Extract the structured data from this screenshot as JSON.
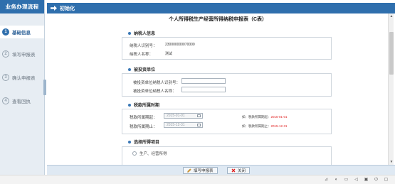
{
  "sidebar": {
    "title": "业务办理流程",
    "items": [
      {
        "num": "1",
        "label": "基础信息",
        "active": true
      },
      {
        "num": "2",
        "label": "填写申报表",
        "active": false
      },
      {
        "num": "3",
        "label": "确认申报表",
        "active": false
      },
      {
        "num": "4",
        "label": "查看回执",
        "active": false
      }
    ]
  },
  "header": {
    "title": "初始化"
  },
  "form": {
    "title": "个人所得税生产经营所得纳税申报表（C表）",
    "taxpayer": {
      "heading": "纳税人信息",
      "id_label": "纳税人识别号：",
      "id_value": "230000000070000",
      "name_label": "纳税人名称：",
      "name_value": "测试"
    },
    "invested": {
      "heading": "被投资单位",
      "id_label": "被投资单位纳税人识别号：",
      "id_value": "",
      "name_label": "被投资单位纳税人名称：",
      "name_value": ""
    },
    "period": {
      "heading": "税款所属时期",
      "start_label": "税款所属期起：",
      "start_value": "2015-01-01",
      "start_hint_prefix": "如：税款所属期起：",
      "start_hint_value": "2015-01-01",
      "end_label": "税款所属期止：",
      "end_value": "2015-12-31",
      "end_hint_prefix": "如：税款所属期止：",
      "end_hint_value": "2015-12-31"
    },
    "income": {
      "heading": "选择所得项目",
      "option_1": "生产、经营所得"
    }
  },
  "actions": {
    "fill_label": "填写申报表",
    "close_label": "关闭"
  },
  "colors": {
    "primary": "#2f6fad",
    "hint_red": "#e02020",
    "sidebar_bg": "#e7edf3"
  }
}
